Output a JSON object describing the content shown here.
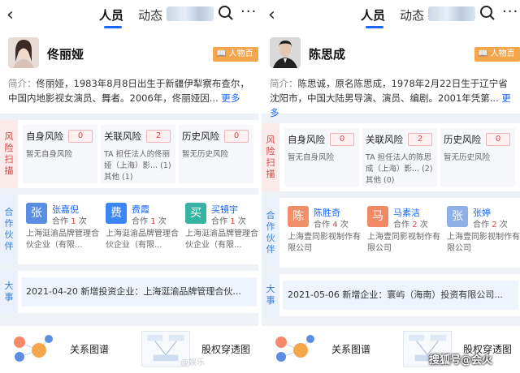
{
  "left": {
    "nav": {
      "back": "<",
      "tab_people": "人员",
      "tab_news": "动态",
      "more": "···"
    },
    "profile": {
      "name": "佟丽娅",
      "wiki": "人物百科",
      "intro_label": "简介：",
      "intro_text": "佟丽娅，1983年8月8日出生于新疆伊犁察布查尔，中国内地影视女演员、舞者。2006年，佟丽娅因...",
      "more": "更多"
    },
    "risk": {
      "tag": [
        "风",
        "险",
        "扫",
        "描"
      ],
      "cards": [
        {
          "title": "自身风险",
          "count": "0",
          "desc": "暂无自身风险"
        },
        {
          "title": "关联风险",
          "count": "2",
          "desc": "TA 担任法人的佟丽娅（上海）影... (1) 其他 (1)"
        },
        {
          "title": "历史风险",
          "count": "0",
          "desc": "暂无历史风险"
        }
      ]
    },
    "partners": {
      "tag": [
        "合",
        "作",
        "伙",
        "伴"
      ],
      "items": [
        {
          "initial": "张",
          "name": "张嘉倪",
          "coop_prefix": "合作 ",
          "coop_n": "1",
          "coop_suffix": " 次",
          "company": "上海涏渝品牌管理合伙企业（有限...",
          "color": "#5b8de0"
        },
        {
          "initial": "费",
          "name": "费霞",
          "coop_prefix": "合作 ",
          "coop_n": "1",
          "coop_suffix": " 次",
          "company": "上海涏渝品牌管理合伙企业（有限...",
          "color": "#3a86f7"
        },
        {
          "initial": "买",
          "name": "买镜宇",
          "coop_prefix": "合作 ",
          "coop_n": "1",
          "coop_suffix": " 次",
          "company": "上海涏渝品牌管理合伙企业（有限...",
          "color": "#37b3a1"
        }
      ]
    },
    "events": {
      "tag": [
        "大",
        "事"
      ],
      "text": "2021-04-20 新增投资企业：上海涏渝品牌管理合伙..."
    },
    "bottom": {
      "graph": "关系图谱",
      "equity": "股权穿透图"
    }
  },
  "right": {
    "nav": {
      "back": "<",
      "tab_people": "人员",
      "tab_news": "动态",
      "more": "···"
    },
    "profile": {
      "name": "陈思成",
      "wiki": "人物百科",
      "intro_label": "简介：",
      "intro_text": "陈思诚，原名陈思成，1978年2月22日生于辽宁省沈阳市，中国大陆男导演、演员、编剧。2001年凭第...",
      "more": "更多"
    },
    "risk": {
      "tag": [
        "风",
        "险",
        "扫",
        "描"
      ],
      "cards": [
        {
          "title": "自身风险",
          "count": "0",
          "desc": "暂无自身风险"
        },
        {
          "title": "关联风险",
          "count": "2",
          "desc": "TA 担任法人的陈思成（上海）影... (2) 其他 (0)"
        },
        {
          "title": "历史风险",
          "count": "0",
          "desc": "暂无历史风险"
        }
      ]
    },
    "partners": {
      "tag": [
        "合",
        "作",
        "伙",
        "伴"
      ],
      "items": [
        {
          "initial": "陈",
          "name": "陈胜奇",
          "coop_prefix": "合作 ",
          "coop_n": "4",
          "coop_suffix": " 次",
          "company": "上海壹同影视制作有限公司",
          "color": "#f0906a"
        },
        {
          "initial": "马",
          "name": "马素洁",
          "coop_prefix": "合作 ",
          "coop_n": "2",
          "coop_suffix": " 次",
          "company": "上海壹同影视制作有限公司",
          "color": "#ef8a65"
        },
        {
          "initial": "张",
          "name": "张婷",
          "coop_prefix": "合作 ",
          "coop_n": "2",
          "coop_suffix": " 次",
          "company": "上海壹同影视制作有限公司",
          "color": "#8fb0e6"
        }
      ]
    },
    "events": {
      "tag": [
        "大",
        "事"
      ],
      "text": "2021-05-06 新增企业：寰屿（海南）投资有限公司..."
    },
    "bottom": {
      "graph": "关系图谱",
      "equity": "股权穿透图"
    }
  },
  "overlay": {
    "sohu": "搜狐号@会火",
    "weibo": "@娱乐"
  }
}
